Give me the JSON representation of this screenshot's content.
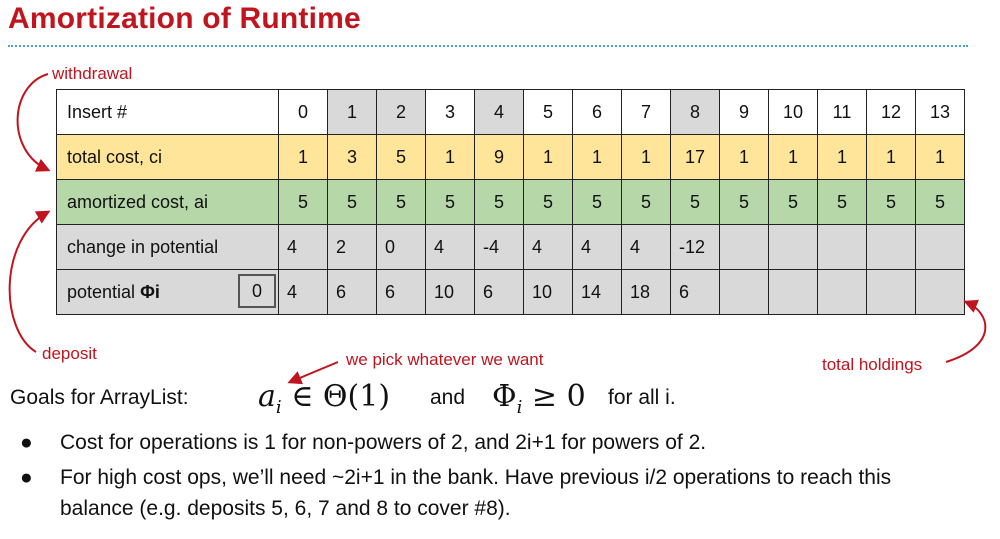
{
  "title": "Amortization of Runtime",
  "annotations": {
    "withdrawal": "withdrawal",
    "deposit": "deposit",
    "pick": "we pick whatever we want",
    "holdings": "total holdings"
  },
  "table": {
    "row_labels": {
      "insert": "Insert #",
      "total": "total cost, ci",
      "amortized": "amortized cost, ai",
      "change": "change in potential",
      "potential_prefix": "potential ",
      "potential_symbol": "Φi",
      "phi0": "0"
    },
    "insert": [
      "0",
      "1",
      "2",
      "3",
      "4",
      "5",
      "6",
      "7",
      "8",
      "9",
      "10",
      "11",
      "12",
      "13"
    ],
    "total": [
      "1",
      "3",
      "5",
      "1",
      "9",
      "1",
      "1",
      "1",
      "17",
      "1",
      "1",
      "1",
      "1",
      "1"
    ],
    "amortized": [
      "5",
      "5",
      "5",
      "5",
      "5",
      "5",
      "5",
      "5",
      "5",
      "5",
      "5",
      "5",
      "5",
      "5"
    ],
    "change": [
      "4",
      "2",
      "0",
      "4",
      "-4",
      "4",
      "4",
      "4",
      "-12",
      "",
      "",
      "",
      "",
      ""
    ],
    "potential": [
      "4",
      "6",
      "6",
      "10",
      "6",
      "10",
      "14",
      "18",
      "6",
      "",
      "",
      "",
      "",
      ""
    ],
    "highlight_columns": [
      1,
      2,
      4,
      8
    ]
  },
  "goals": {
    "label": "Goals for ArrayList:",
    "math1": "a_i ∈ Θ(1)",
    "and": "and",
    "math2": "Φ_i ≥ 0",
    "for_all": "for all i."
  },
  "bullets": [
    "Cost for operations is 1 for non-powers of 2, and 2i+1 for powers of 2.",
    "For high cost ops, we’ll need ~2i+1 in the bank. Have previous i/2 operations to reach this balance (e.g. deposits 5, 6, 7 and 8 to cover #8)."
  ],
  "colors": {
    "title": "#c0151f",
    "total_row": "#ffe599",
    "amortized_row": "#b6d7a8",
    "grey": "#d9d9d9",
    "dots": "#4aa3d0"
  }
}
